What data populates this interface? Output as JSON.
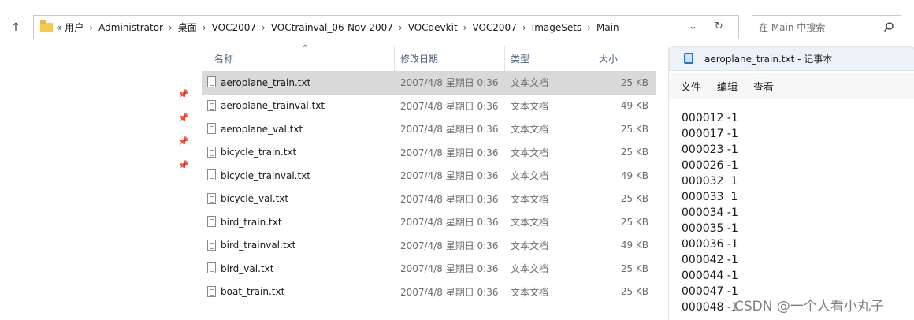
{
  "address_bar": {
    "overflow": "«",
    "crumbs": [
      "用户",
      "Administrator",
      "桌面",
      "VOC2007",
      "VOCtrainval_06-Nov-2007",
      "VOCdevkit",
      "VOC2007",
      "ImageSets",
      "Main"
    ],
    "separator": "›"
  },
  "search": {
    "placeholder": "在 Main 中搜索"
  },
  "file_list": {
    "headers": {
      "name": "名称",
      "date": "修改日期",
      "type": "类型",
      "size": "大小"
    },
    "rows": [
      {
        "name": "aeroplane_train.txt",
        "date": "2007/4/8 星期日 0:36",
        "type": "文本文档",
        "size": "25 KB"
      },
      {
        "name": "aeroplane_trainval.txt",
        "date": "2007/4/8 星期日 0:36",
        "type": "文本文档",
        "size": "49 KB"
      },
      {
        "name": "aeroplane_val.txt",
        "date": "2007/4/8 星期日 0:36",
        "type": "文本文档",
        "size": "25 KB"
      },
      {
        "name": "bicycle_train.txt",
        "date": "2007/4/8 星期日 0:36",
        "type": "文本文档",
        "size": "25 KB"
      },
      {
        "name": "bicycle_trainval.txt",
        "date": "2007/4/8 星期日 0:36",
        "type": "文本文档",
        "size": "49 KB"
      },
      {
        "name": "bicycle_val.txt",
        "date": "2007/4/8 星期日 0:36",
        "type": "文本文档",
        "size": "25 KB"
      },
      {
        "name": "bird_train.txt",
        "date": "2007/4/8 星期日 0:36",
        "type": "文本文档",
        "size": "25 KB"
      },
      {
        "name": "bird_trainval.txt",
        "date": "2007/4/8 星期日 0:36",
        "type": "文本文档",
        "size": "49 KB"
      },
      {
        "name": "bird_val.txt",
        "date": "2007/4/8 星期日 0:36",
        "type": "文本文档",
        "size": "25 KB"
      },
      {
        "name": "boat_train.txt",
        "date": "2007/4/8 星期日 0:36",
        "type": "文本文档",
        "size": "25 KB"
      }
    ],
    "selected_index": 0
  },
  "notepad": {
    "title": "aeroplane_train.txt - 记事本",
    "menu": {
      "file": "文件",
      "edit": "编辑",
      "view": "查看"
    },
    "lines": [
      "000012 -1",
      "000017 -1",
      "000023 -1",
      "000026 -1",
      "000032  1",
      "000033  1",
      "000034 -1",
      "000035 -1",
      "000036 -1",
      "000042 -1",
      "000044 -1",
      "000047 -1",
      "000048 -1"
    ]
  },
  "watermark": "CSDN @一个人看小丸子",
  "icons": {
    "up": "up-arrow-icon",
    "folder": "folder-icon",
    "refresh": "refresh-icon",
    "dropdown": "chevron-down-icon",
    "search": "search-icon",
    "pin": "pin-icon",
    "file": "text-file-icon",
    "notepad": "notepad-icon"
  },
  "colors": {
    "accent": "#2a6fbf",
    "selected_row": "#d9d9d9",
    "header_text": "#4c607a"
  }
}
